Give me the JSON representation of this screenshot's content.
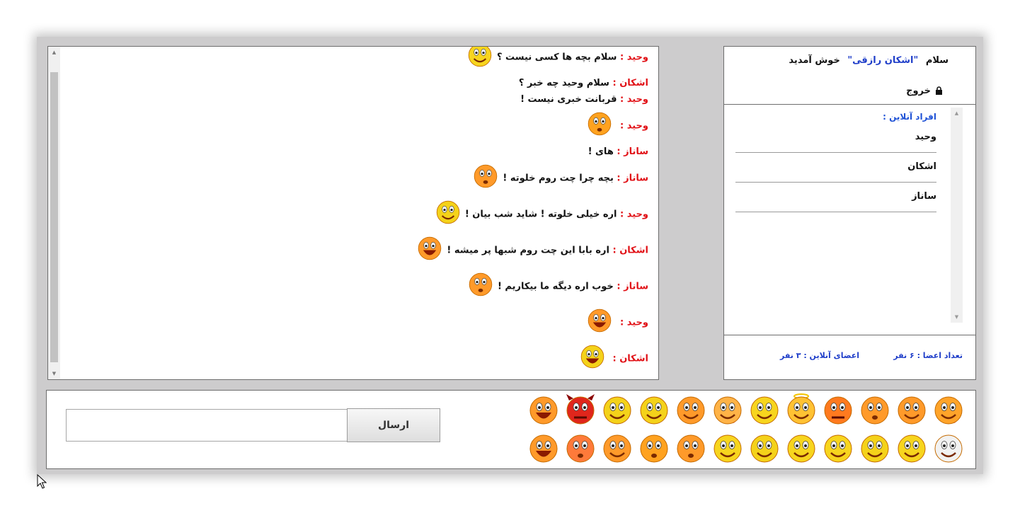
{
  "header": {
    "greeting": "سلام",
    "username": "\"اشکان رازقی\"",
    "welcome": "خوش آمدید",
    "logout_label": "خروج"
  },
  "online": {
    "title": "افراد آنلاین :",
    "users": [
      "وحید",
      "اشکان",
      "ساناز"
    ],
    "members_count": "تعداد اعضا : ۶ نفر",
    "online_count": "اعضای آنلاین : ۳ نفر"
  },
  "chat": {
    "messages": [
      {
        "sender": "وحید :",
        "text": "سلام بچه ها کسی نیست ؟",
        "emoji": "yellow-wave-emoji-icon"
      },
      {
        "sender": "اشکان :",
        "text": "سلام وحید چه خبر ؟",
        "emoji": ""
      },
      {
        "sender": "وحید :",
        "text": "قربانت خبری نیست !",
        "emoji": ""
      },
      {
        "sender": "وحید :",
        "text": "",
        "emoji": "rolling-eyes-emoji-icon"
      },
      {
        "sender": "ساناز :",
        "text": "های !",
        "emoji": ""
      },
      {
        "sender": "ساناز :",
        "text": "بچه چرا چت روم خلوته !",
        "emoji": "surprised-emoji-icon"
      },
      {
        "sender": "وحید :",
        "text": "اره خیلی خلوته ! شاید شب بیان !",
        "emoji": "thinking-emoji-icon"
      },
      {
        "sender": "اشکان :",
        "text": "اره بابا این چت روم شبها پر میشه !",
        "emoji": "laughing-emoji-icon"
      },
      {
        "sender": "ساناز :",
        "text": "خوب اره دیگه ما بیکاریم !",
        "emoji": "worried-emoji-icon"
      },
      {
        "sender": "وحید :",
        "text": "",
        "emoji": "laughing-books-emoji-icon"
      },
      {
        "sender": "اشکان :",
        "text": "",
        "emoji": "laughing-thinking-emoji-icon"
      }
    ]
  },
  "composer": {
    "send_label": "ارسال",
    "input_value": "",
    "input_placeholder": ""
  },
  "colors": {
    "sender": "#e11016",
    "username": "#1f3ec9",
    "online_title": "#1f52d6",
    "window_bg": "#cdcccd"
  },
  "emojis": {
    "row1": [
      "heart-kiss-emoji-icon",
      "winking-emoji-icon",
      "wide-eyed-emoji-icon",
      "angry-emoji-icon",
      "angel-emoji-icon",
      "reindeer-emoji-icon",
      "i-love-you-emoji-icon",
      "sunglasses-emoji-icon",
      "trumpet-emoji-icon",
      "sleepy-emoji-icon",
      "devil-emoji-icon",
      "big-laugh-emoji-icon"
    ],
    "row2": [
      "violin-emoji-icon",
      "drummer-emoji-icon",
      "thinking-emoji-icon",
      "dancing-emoji-icon",
      "books-emoji-icon",
      "santa-emoji-icon",
      "hug-emoji-icon",
      "surprised-emoji-icon",
      "rolling-eyes-emoji-icon",
      "door-emoji-icon",
      "scared-emoji-icon",
      "cookie-emoji-icon"
    ]
  }
}
